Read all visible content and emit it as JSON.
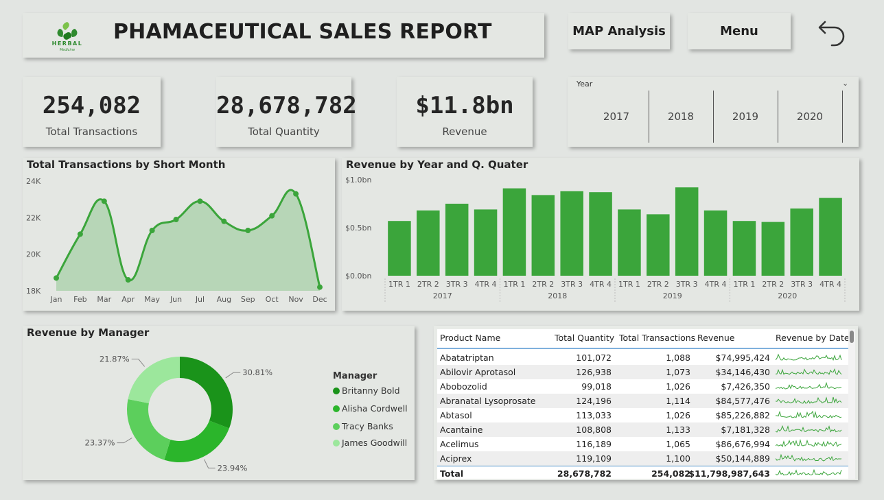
{
  "header": {
    "title": "PHAMACEUTICAL SALES REPORT",
    "logo_text": "HERBAL",
    "logo_sub": "Medicine",
    "map_button": "MAP Analysis",
    "menu_button": "Menu"
  },
  "kpis": [
    {
      "value": "254,082",
      "label": "Total Transactions"
    },
    {
      "value": "28,678,782",
      "label": "Total Quantity"
    },
    {
      "value": "$11.8bn",
      "label": "Revenue"
    }
  ],
  "slicer": {
    "title": "Year",
    "options": [
      "2017",
      "2018",
      "2019",
      "2020"
    ]
  },
  "colors": {
    "green": "#3ba53b",
    "area_fill": "#b7d6b7",
    "donut": [
      "#1a931a",
      "#2bb52b",
      "#5ccf5c",
      "#9ce79c"
    ]
  },
  "chart_data": [
    {
      "type": "area",
      "title": "Total Transactions by Short Month",
      "categories": [
        "Jan",
        "Feb",
        "Mar",
        "Apr",
        "May",
        "Jun",
        "Jul",
        "Aug",
        "Sep",
        "Oct",
        "Nov",
        "Dec"
      ],
      "values": [
        18700,
        21100,
        22900,
        18600,
        21300,
        21900,
        22900,
        21800,
        21300,
        22100,
        23300,
        18200
      ],
      "yticks": [
        "24K",
        "22K",
        "20K",
        "18K"
      ],
      "ytick_values": [
        24000,
        22000,
        20000,
        18000
      ],
      "ylim": [
        18000,
        24000
      ],
      "xlabel": "",
      "ylabel": ""
    },
    {
      "type": "bar",
      "title": "Revenue by Year and Q. Quater",
      "categories": [
        "1TR 1",
        "2TR 2",
        "3TR 3",
        "4TR 4",
        "1TR 1",
        "2TR 2",
        "3TR 3",
        "4TR 4",
        "1TR 1",
        "2TR 2",
        "3TR 3",
        "4TR 4",
        "1TR 1",
        "2TR 2",
        "3TR 3",
        "4TR 4"
      ],
      "groups": [
        "2017",
        "2018",
        "2019",
        "2020"
      ],
      "values": [
        0.57,
        0.68,
        0.75,
        0.69,
        0.91,
        0.84,
        0.88,
        0.87,
        0.69,
        0.64,
        0.92,
        0.68,
        0.57,
        0.56,
        0.7,
        0.81
      ],
      "yticks": [
        "$1.0bn",
        "$0.5bn",
        "$0.0bn"
      ],
      "ytick_values": [
        1.0,
        0.5,
        0.0
      ],
      "ylim": [
        0,
        1.0
      ],
      "xlabel": "",
      "ylabel": ""
    },
    {
      "type": "pie",
      "title": "Revenue by Manager",
      "legend_title": "Manager",
      "labels": [
        "Britanny Bold",
        "Alisha Cordwell",
        "Tracy Banks",
        "James Goodwill"
      ],
      "values": [
        30.81,
        23.94,
        23.37,
        21.87
      ],
      "value_labels": [
        "30.81%",
        "23.94%",
        "23.37%",
        "21.87%"
      ],
      "legend_position": "right"
    },
    {
      "type": "table",
      "columns": [
        "Product Name",
        "Total Quantity",
        "Total Transactions",
        "Revenue",
        "Revenue by Date"
      ],
      "rows": [
        {
          "name": "Abatatriptan",
          "qty": "101,072",
          "trx": "1,088",
          "rev": "$74,995,424"
        },
        {
          "name": "Abilovir Aprotasol",
          "qty": "126,938",
          "trx": "1,073",
          "rev": "$34,146,430"
        },
        {
          "name": "Abobozolid",
          "qty": "99,018",
          "trx": "1,026",
          "rev": "$7,426,350"
        },
        {
          "name": "Abranatal Lysoprosate",
          "qty": "124,196",
          "trx": "1,114",
          "rev": "$84,577,476"
        },
        {
          "name": "Abtasol",
          "qty": "113,033",
          "trx": "1,026",
          "rev": "$85,226,882"
        },
        {
          "name": "Acantaine",
          "qty": "108,808",
          "trx": "1,133",
          "rev": "$7,181,328"
        },
        {
          "name": "Acelimus",
          "qty": "116,189",
          "trx": "1,065",
          "rev": "$86,676,994"
        },
        {
          "name": "Aciprex",
          "qty": "119,109",
          "trx": "1,100",
          "rev": "$50,144,889"
        }
      ],
      "total": {
        "name": "Total",
        "qty": "28,678,782",
        "trx": "254,082",
        "rev": "$11,798,987,643"
      }
    }
  ]
}
